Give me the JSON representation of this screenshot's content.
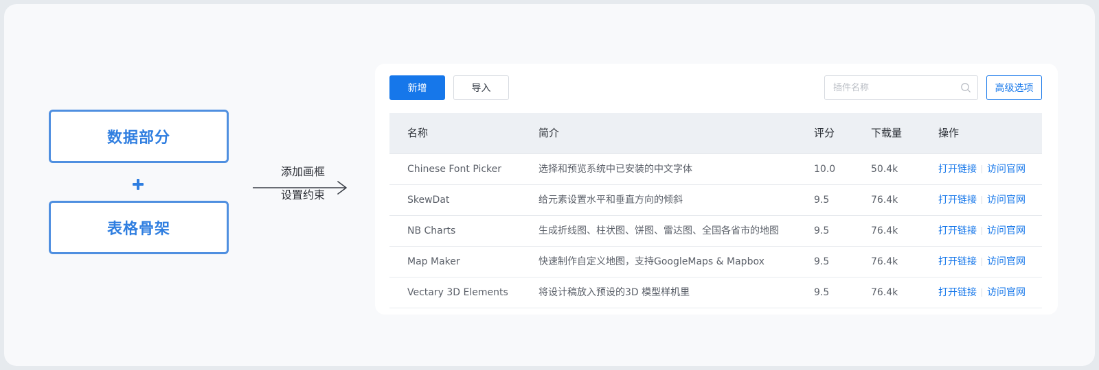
{
  "concept": {
    "top_box": "数据部分",
    "bottom_box": "表格骨架",
    "arrow_label_top": "添加画框",
    "arrow_label_bottom": "设置约束"
  },
  "toolbar": {
    "add_label": "新增",
    "import_label": "导入",
    "search_placeholder": "插件名称",
    "advanced_label": "高级选项"
  },
  "table": {
    "headers": {
      "name": "名称",
      "desc": "简介",
      "score": "评分",
      "downloads": "下载量",
      "actions": "操作"
    },
    "rows": [
      {
        "name": "Chinese Font Picker",
        "desc": "选择和预览系统中已安装的中文字体",
        "score": "10.0",
        "downloads": "50.4k",
        "open": "打开链接",
        "visit": "访问官网"
      },
      {
        "name": "SkewDat",
        "desc": "给元素设置水平和垂直方向的倾斜",
        "score": "9.5",
        "downloads": "76.4k",
        "open": "打开链接",
        "visit": "访问官网"
      },
      {
        "name": "NB Charts",
        "desc": "生成折线图、柱状图、饼图、雷达图、全国各省市的地图",
        "score": "9.5",
        "downloads": "76.4k",
        "open": "打开链接",
        "visit": "访问官网"
      },
      {
        "name": "Map Maker",
        "desc": "快速制作自定义地图，支持GoogleMaps & Mapbox",
        "score": "9.5",
        "downloads": "76.4k",
        "open": "打开链接",
        "visit": "访问官网"
      },
      {
        "name": "Vectary 3D Elements",
        "desc": "将设计稿放入预设的3D 模型样机里",
        "score": "9.5",
        "downloads": "76.4k",
        "open": "打开链接",
        "visit": "访问官网"
      }
    ]
  },
  "colors": {
    "primary": "#1677ea",
    "concept_blue": "#2f7ee0",
    "header_bg": "#edf0f4"
  },
  "icons": {
    "search": "search-icon",
    "plus": "plus-icon",
    "arrow": "arrow-right-icon"
  }
}
